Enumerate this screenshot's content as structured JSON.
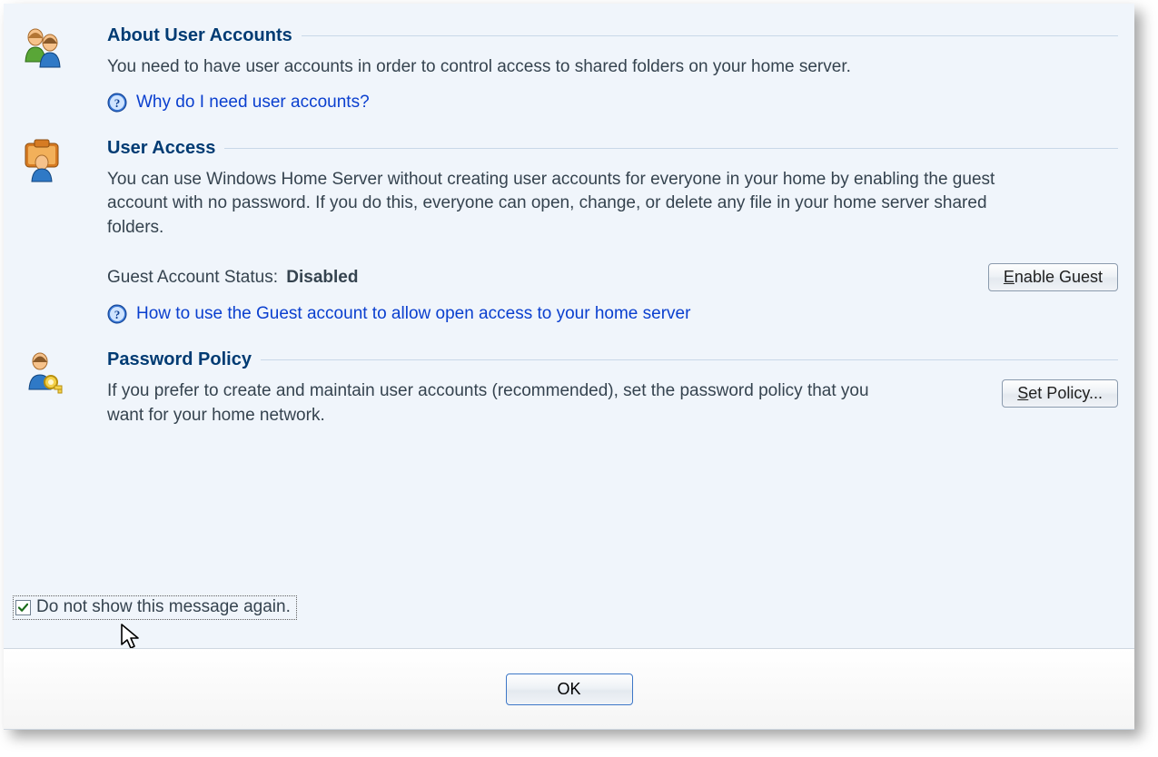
{
  "sections": {
    "about": {
      "heading": "About User Accounts",
      "desc": "You need to have user accounts in order to control access to shared folders on your home server.",
      "help_link": "Why do I need user accounts?"
    },
    "access": {
      "heading": "User Access",
      "desc": "You can use Windows Home Server without creating user accounts for everyone in your home by enabling the guest account with no password.  If you do this, everyone can open, change, or delete any file in your home server shared folders.",
      "status_label": "Guest Account Status:",
      "status_value": "Disabled",
      "enable_button_prefix": "E",
      "enable_button_rest": "nable Guest",
      "help_link": "How to use the Guest account to allow open access to your home server"
    },
    "policy": {
      "heading": "Password Policy",
      "desc": "If you prefer to create and maintain user accounts (recommended), set the password policy that you want for your home network.",
      "button_prefix": "S",
      "button_rest": "et Policy..."
    }
  },
  "checkbox": {
    "checked": true,
    "label": "Do not show this message again."
  },
  "footer": {
    "ok_label": "OK"
  }
}
